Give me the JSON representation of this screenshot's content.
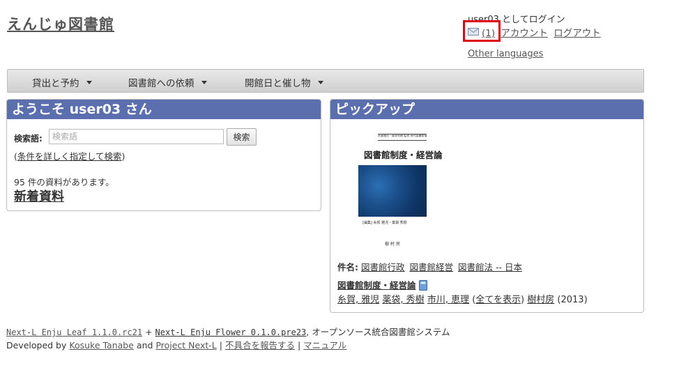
{
  "header": {
    "logo": "えんじゅ図書館",
    "login_status": "user03 としてログイン",
    "messages_count": "(1)",
    "account_link": "アカウント",
    "logout_link": "ログアウト",
    "other_languages": "Other languages",
    "highlight_color": "#e0000c"
  },
  "menu": {
    "items": [
      {
        "label": "貸出と予約"
      },
      {
        "label": "図書館への依頼"
      },
      {
        "label": "開館日と催し物"
      }
    ]
  },
  "welcome_panel": {
    "title": "ようこそ user03 さん",
    "search_label": "検索語:",
    "search_placeholder": "検索語",
    "search_button": "検索",
    "advanced_open": "(",
    "advanced_link": "条件を詳しく指定して検索",
    "advanced_close": ")",
    "item_count_text": "95 件の資料があります。",
    "new_items_link": "新着資料",
    "header_color": "#5b6fae"
  },
  "pickup_panel": {
    "title": "ピックアップ",
    "cover": {
      "series": "糸賀雅児・薬袋秀樹 監修 現代図書館情報学シリーズ…2",
      "title": "図書館制度・経営論",
      "author": "[編集] 糸賀 雅児・薬袋 秀樹",
      "publisher": "樹 村 房"
    },
    "subjects_label": "件名:",
    "subjects": [
      "図書館行政",
      "図書館経営",
      "図書館法 -- 日本"
    ],
    "book_title": "図書館制度・経営論",
    "authors": [
      "糸賀, 雅児",
      "薬袋, 秀樹",
      "市川, 恵理"
    ],
    "show_all_open": "(",
    "show_all": "全てを表示",
    "show_all_close": ")",
    "publisher": "樹村房",
    "year": "(2013)"
  },
  "footer": {
    "leaf_version": "Next-L Enju Leaf 1.1.0.rc21",
    "plus": "+",
    "flower_version": "Next-L Enju Flower 0.1.0.pre23",
    "tagline": ", オープンソース統合図書館システム",
    "developed_by": "Developed by",
    "developer": "Kosuke Tanabe",
    "and": "and",
    "project": "Project Next-L",
    "sep": "|",
    "report_bug": "不具合を報告する",
    "manual": "マニュアル"
  }
}
